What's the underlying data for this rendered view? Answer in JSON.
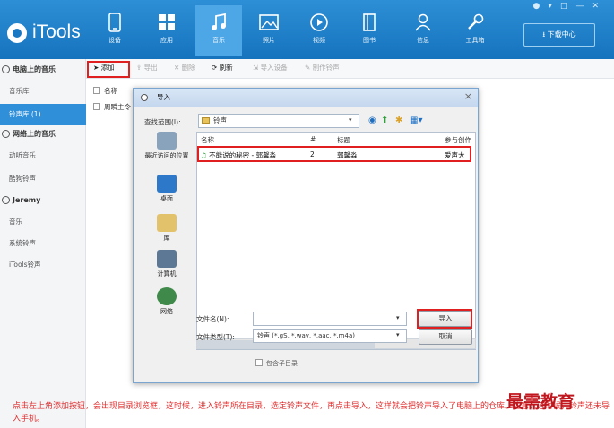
{
  "app": {
    "name": "iTools"
  },
  "window_controls": [
    "●",
    "▾",
    "□",
    "—",
    "✕"
  ],
  "nav": [
    {
      "label": "设备",
      "icon": "device-icon"
    },
    {
      "label": "应用",
      "icon": "apps-icon"
    },
    {
      "label": "音乐",
      "icon": "music-icon",
      "active": true
    },
    {
      "label": "照片",
      "icon": "photo-icon"
    },
    {
      "label": "视频",
      "icon": "video-icon"
    },
    {
      "label": "图书",
      "icon": "book-icon"
    },
    {
      "label": "信息",
      "icon": "contacts-icon"
    },
    {
      "label": "工具箱",
      "icon": "tools-icon"
    }
  ],
  "download_center": "下载中心",
  "sidebar": {
    "sections": [
      {
        "title": "电脑上的音乐",
        "items": [
          "音乐库",
          "铃声库 (1)"
        ]
      },
      {
        "title": "网络上的音乐",
        "items": [
          "动听音乐",
          "酷狗铃声"
        ]
      },
      {
        "title": "Jeremy",
        "items": [
          "音乐",
          "系统铃声",
          "iTools铃声"
        ]
      }
    ],
    "active_item": "铃声库 (1)"
  },
  "toolbar": {
    "add": "添加",
    "export": "导出",
    "delete": "删除",
    "refresh": "刷新",
    "import_device": "导入设备",
    "make_ringtone": "制作铃声"
  },
  "list": {
    "header_name": "名称",
    "row1": "周瞬主令"
  },
  "dialog": {
    "title": "导入",
    "lookin_label": "查找范围(I):",
    "lookin_value": "铃声",
    "places": [
      "最近访问的位置",
      "桌面",
      "库",
      "计算机",
      "网络"
    ],
    "columns": [
      "名称",
      "#",
      "标题",
      "参与创作"
    ],
    "file": {
      "name": "不能说的秘密 - 郭馨淼",
      "num": "2",
      "title": "郭馨淼",
      "artist": "爱声大"
    },
    "filename_label": "文件名(N):",
    "filetype_label": "文件类型(T):",
    "filetype_value": "铃声 (*.gS, *.wav, *.aac, *.m4a)",
    "import_button": "导入",
    "cancel_button": "取消",
    "subdir_label": "包含子目录"
  },
  "tip": "点击左上角添加按钮，会出现目录浏览框，这时候，进入铃声所在目录，选定铃声文件，再点击导入，这样就会把铃声导入了电脑上的仓库。注意，这时候，铃声还未导入手机。",
  "watermark": "最需教育",
  "colors": {
    "brand": "#1a7cc7",
    "highlight": "#e02020",
    "tip": "#e03030",
    "watermark": "#c0161d"
  }
}
